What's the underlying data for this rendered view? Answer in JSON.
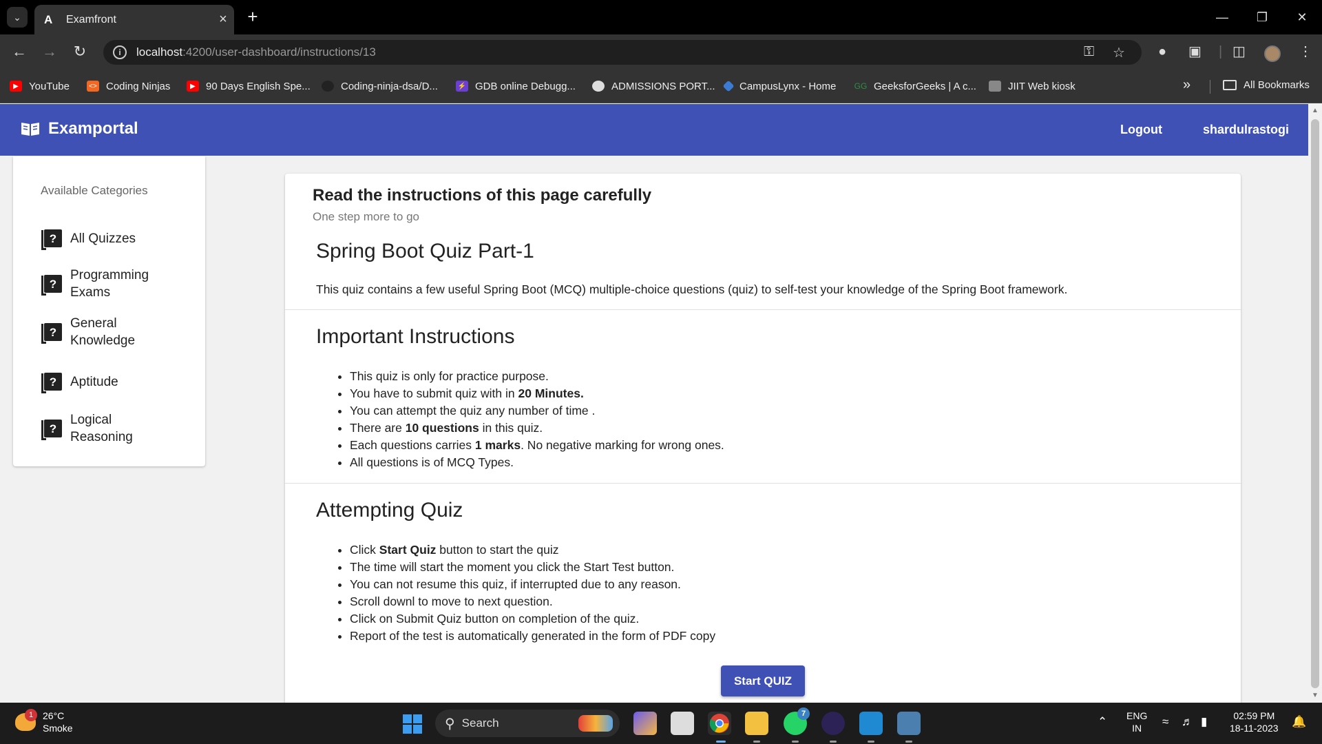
{
  "browser": {
    "tab_title": "Examfront",
    "url_host": "localhost",
    "url_path": ":4200/user-dashboard/instructions/13",
    "bookmarks": [
      {
        "label": "YouTube",
        "color": "#ff0000"
      },
      {
        "label": "Coding Ninjas",
        "color": "#f26722"
      },
      {
        "label": "90 Days English Spe...",
        "color": "#ff0000"
      },
      {
        "label": "Coding-ninja-dsa/D...",
        "color": "#333333"
      },
      {
        "label": "GDB online Debugg...",
        "color": "#6b3fd4"
      },
      {
        "label": "ADMISSIONS PORT...",
        "color": "#dddddd"
      },
      {
        "label": "CampusLynx - Home",
        "color": "#3b7bd4"
      },
      {
        "label": "GeeksforGeeks | A c...",
        "color": "#2f8d46"
      },
      {
        "label": "JIIT Web kiosk",
        "color": "#888888"
      }
    ],
    "all_bookmarks": "All Bookmarks"
  },
  "app": {
    "brand": "Examportal",
    "logout": "Logout",
    "username": "shardulrastogi",
    "accent": "#3f51b5"
  },
  "sidebar": {
    "heading": "Available Categories",
    "items": [
      {
        "label": "All Quizzes"
      },
      {
        "label": "Programming Exams"
      },
      {
        "label": "General Knowledge"
      },
      {
        "label": "Aptitude"
      },
      {
        "label": "Logical Reasoning"
      }
    ]
  },
  "card": {
    "title": "Read the instructions of this page carefully",
    "subtitle": "One step more to go",
    "quiz_title": "Spring Boot Quiz Part-1",
    "quiz_description": "This quiz contains a few useful Spring Boot (MCQ) multiple-choice questions (quiz) to self-test your knowledge of the Spring Boot framework.",
    "important_heading": "Important Instructions",
    "important_items": [
      {
        "pre": "This quiz is only for practice purpose.",
        "bold": "",
        "post": ""
      },
      {
        "pre": "You have to submit quiz with in ",
        "bold": "20 Minutes.",
        "post": ""
      },
      {
        "pre": "You can attempt the quiz any number of time .",
        "bold": "",
        "post": ""
      },
      {
        "pre": "There are ",
        "bold": "10 questions",
        "post": " in this quiz."
      },
      {
        "pre": "Each questions carries ",
        "bold": "1 marks",
        "post": ". No negative marking for wrong ones."
      },
      {
        "pre": "All questions is of MCQ Types.",
        "bold": "",
        "post": ""
      }
    ],
    "attempting_heading": "Attempting Quiz",
    "attempting_items": [
      {
        "pre": "Click ",
        "bold": "Start Quiz",
        "post": " button to start the quiz"
      },
      {
        "pre": "The time will start the moment you click the Start Test button.",
        "bold": "",
        "post": ""
      },
      {
        "pre": "You can not resume this quiz, if interrupted due to any reason.",
        "bold": "",
        "post": ""
      },
      {
        "pre": "Scroll downl to move to next question.",
        "bold": "",
        "post": ""
      },
      {
        "pre": "Click on Submit Quiz button on completion of the quiz.",
        "bold": "",
        "post": ""
      },
      {
        "pre": "Report of the test is automatically generated in the form of PDF copy",
        "bold": "",
        "post": ""
      }
    ],
    "start_button": "Start QUIZ"
  },
  "taskbar": {
    "temperature": "26°C",
    "weather": "Smoke",
    "weather_badge": "1",
    "search": "Search",
    "language": "ENG",
    "region": "IN",
    "time": "02:59 PM",
    "date": "18-11-2023",
    "whatsapp_badge": "7"
  }
}
